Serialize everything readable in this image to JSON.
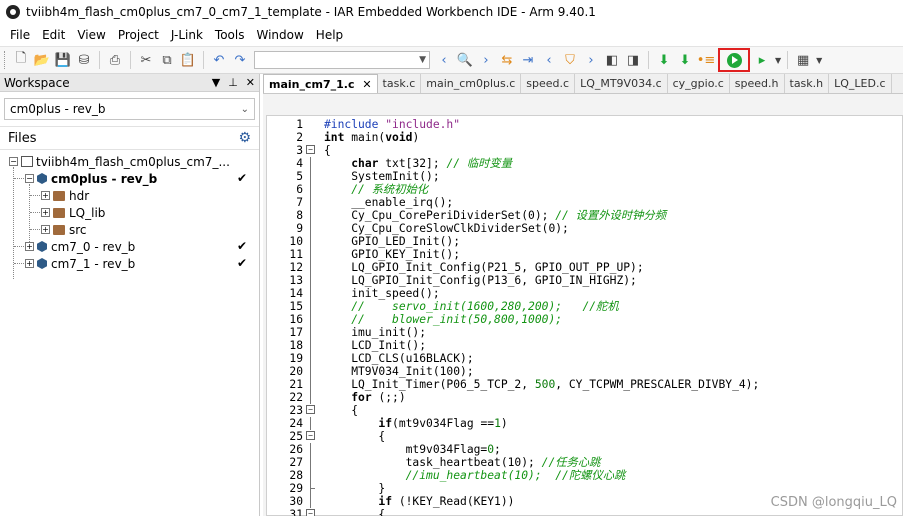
{
  "window": {
    "title": "tviibh4m_flash_cm0plus_cm7_0_cm7_1_template - IAR Embedded Workbench IDE - Arm 9.40.1"
  },
  "menu": [
    "File",
    "Edit",
    "View",
    "Project",
    "J-Link",
    "Tools",
    "Window",
    "Help"
  ],
  "toolbar": {
    "config_combo_value": ""
  },
  "workspace": {
    "header": "Workspace",
    "config": "cm0plus - rev_b",
    "files_label": "Files",
    "tree": {
      "root": "tviibh4m_flash_cm0plus_cm7_...",
      "project_cm0": "cm0plus - rev_b",
      "folders": [
        "hdr",
        "LQ_lib",
        "src"
      ],
      "project_cm7_0": "cm7_0 - rev_b",
      "project_cm7_1": "cm7_1 - rev_b",
      "check": "✔"
    }
  },
  "tabs": [
    "main_cm7_1.c",
    "task.c",
    "main_cm0plus.c",
    "speed.c",
    "LQ_MT9V034.c",
    "cy_gpio.c",
    "speed.h",
    "task.h",
    "LQ_LED.c"
  ],
  "active_tab_close": "✕",
  "code_lines": [
    [
      [
        "pp",
        "#include "
      ],
      [
        "str",
        "\"include.h\""
      ]
    ],
    [
      [
        "kw",
        "int "
      ],
      [
        "plain",
        "main("
      ],
      [
        "kw",
        "void"
      ],
      [
        "plain",
        ")"
      ]
    ],
    [
      [
        "plain",
        "{"
      ]
    ],
    [
      [
        "plain",
        "    "
      ],
      [
        "kw",
        "char "
      ],
      [
        "plain",
        "txt[32]; "
      ],
      [
        "cm",
        "// 临时变量"
      ]
    ],
    [
      [
        "plain",
        "    SystemInit();"
      ]
    ],
    [
      [
        "plain",
        "    "
      ],
      [
        "cm",
        "// 系统初始化"
      ]
    ],
    [
      [
        "plain",
        "    __enable_irq();"
      ]
    ],
    [
      [
        "plain",
        "    Cy_Cpu_CorePeriDividerSet(0); "
      ],
      [
        "cm",
        "// 设置外设时钟分频"
      ]
    ],
    [
      [
        "plain",
        "    Cy_Cpu_CoreSlowClkDividerSet(0);"
      ]
    ],
    [
      [
        "plain",
        "    GPIO_LED_Init();"
      ]
    ],
    [
      [
        "plain",
        "    GPIO_KEY_Init();"
      ]
    ],
    [
      [
        "plain",
        "    LQ_GPIO_Init_Config(P21_5, GPIO_OUT_PP_UP);"
      ]
    ],
    [
      [
        "plain",
        "    LQ_GPIO_Init_Config(P13_6, GPIO_IN_HIGHZ);"
      ]
    ],
    [
      [
        "plain",
        "    init_speed();"
      ]
    ],
    [
      [
        "cm",
        "    //    servo_init(1600,280,200);   //舵机"
      ]
    ],
    [
      [
        "cm",
        "    //    blower_init(50,800,1000);"
      ]
    ],
    [
      [
        "plain",
        "    imu_init();"
      ]
    ],
    [
      [
        "plain",
        "    LCD_Init();"
      ]
    ],
    [
      [
        "plain",
        "    LCD_CLS(u16BLACK);"
      ]
    ],
    [
      [
        "plain",
        "    MT9V034_Init(100);"
      ]
    ],
    [
      [
        "plain",
        "    LQ_Init_Timer(P06_5_TCP_2, "
      ],
      [
        "num",
        "500"
      ],
      [
        "plain",
        ", CY_TCPWM_PRESCALER_DIVBY_4);"
      ]
    ],
    [
      [
        "plain",
        "    "
      ],
      [
        "kw",
        "for "
      ],
      [
        "plain",
        "(;;)"
      ]
    ],
    [
      [
        "plain",
        "    {"
      ]
    ],
    [
      [
        "plain",
        "        "
      ],
      [
        "kw",
        "if"
      ],
      [
        "plain",
        "(mt9v034Flag =="
      ],
      [
        "num",
        "1"
      ],
      [
        "plain",
        ")"
      ]
    ],
    [
      [
        "plain",
        "        {"
      ]
    ],
    [
      [
        "plain",
        "            mt9v034Flag="
      ],
      [
        "num",
        "0"
      ],
      [
        "plain",
        ";"
      ]
    ],
    [
      [
        "plain",
        "            task_heartbeat(10); "
      ],
      [
        "cm",
        "//任务心跳"
      ]
    ],
    [
      [
        "cm",
        "            //imu_heartbeat(10);  //陀螺仪心跳"
      ]
    ],
    [
      [
        "plain",
        "        }"
      ]
    ],
    [
      [
        "plain",
        "        "
      ],
      [
        "kw",
        "if "
      ],
      [
        "plain",
        "(!KEY_Read(KEY1))"
      ]
    ],
    [
      [
        "plain",
        "        {"
      ]
    ]
  ],
  "watermark": "CSDN @longqiu_LQ"
}
